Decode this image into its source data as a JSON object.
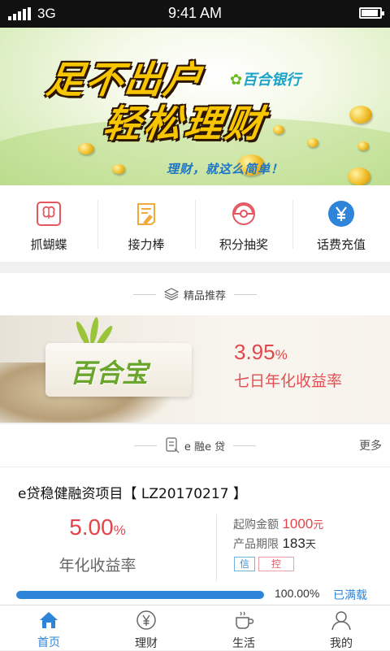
{
  "status_bar": {
    "carrier": "3G",
    "time": "9:41 AM",
    "battery_level": 0.9
  },
  "banner": {
    "title_line1": "足不出户",
    "title_line2": "轻松理财",
    "bank_logo": "百合银行",
    "slogan": "理财，就这么简单！"
  },
  "quick_actions": [
    {
      "label": "抓蝴蝶",
      "icon": "butterfly-icon",
      "color": "#e5575f"
    },
    {
      "label": "接力棒",
      "icon": "broom-icon",
      "color": "#f2a93b"
    },
    {
      "label": "积分抽奖",
      "icon": "lottery-icon",
      "color": "#e5575f"
    },
    {
      "label": "话费充值",
      "icon": "yen-circle-icon",
      "color": "#2e84d9"
    }
  ],
  "featured": {
    "section_title": "精品推荐"
  },
  "promo": {
    "brand": "百合宝",
    "rate_value": "3.95",
    "rate_unit": "%",
    "rate_label": "七日年化收益率"
  },
  "eloan": {
    "section_title": "e 融e 贷",
    "more_label": "更多"
  },
  "loan_item": {
    "title": "e贷稳健融资项目【 LZ20170217 】",
    "rate_value": "5.00",
    "rate_unit": "%",
    "rate_label": "年化收益率",
    "min_amount_label": "起购金额",
    "min_amount_value": "1000",
    "min_amount_unit": "元",
    "term_label": "产品期限",
    "term_value": "183",
    "term_unit": "天",
    "tag_credit": "信",
    "tag_control": "控",
    "progress": 1.0,
    "progress_text": "100.00%",
    "status_text": "已满载"
  },
  "tabs": [
    {
      "label": "首页",
      "icon": "home-icon",
      "active": true
    },
    {
      "label": "理财",
      "icon": "yen-circle-icon",
      "active": false
    },
    {
      "label": "生活",
      "icon": "coffee-cup-icon",
      "active": false
    },
    {
      "label": "我的",
      "icon": "user-icon",
      "active": false
    }
  ],
  "colors": {
    "accent": "#2e84d9",
    "rate_red": "#e34349",
    "banner_yellow": "#f7c600"
  }
}
